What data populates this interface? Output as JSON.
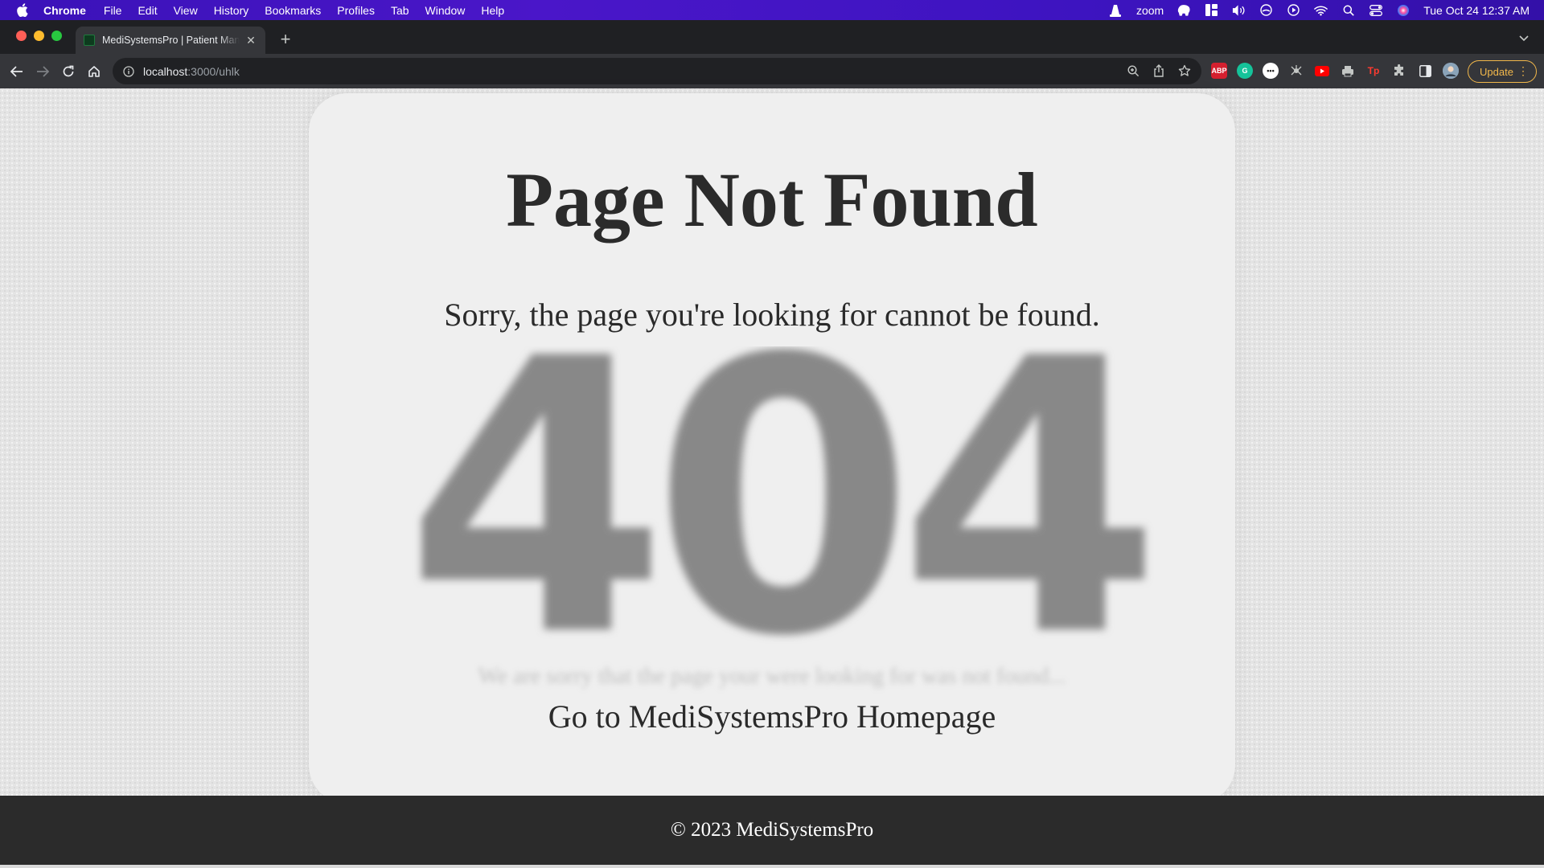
{
  "menubar": {
    "app_name": "Chrome",
    "items": [
      "File",
      "Edit",
      "View",
      "History",
      "Bookmarks",
      "Profiles",
      "Tab",
      "Window",
      "Help"
    ],
    "status": {
      "zoom_label": "zoom",
      "clock": "Tue Oct 24  12:37 AM"
    }
  },
  "browser": {
    "tab_title": "MediSystemsPro | Patient Man",
    "url_host": "localhost",
    "url_path": ":3000/uhlk",
    "update_label": "Update"
  },
  "page": {
    "heading": "Page Not Found",
    "subtitle": "Sorry, the page you're looking for cannot be found.",
    "graphic_text": "404",
    "faded_text": "We are sorry that the page your were looking for was not found...",
    "home_link": "Go to MediSystemsPro Homepage",
    "footer": "© 2023 MediSystemsPro"
  },
  "colors": {
    "menubar": "#3f14c2",
    "card": "#efefef",
    "footer": "#2b2b2b",
    "graphic": "#888888",
    "update_accent": "#f2b84b"
  }
}
